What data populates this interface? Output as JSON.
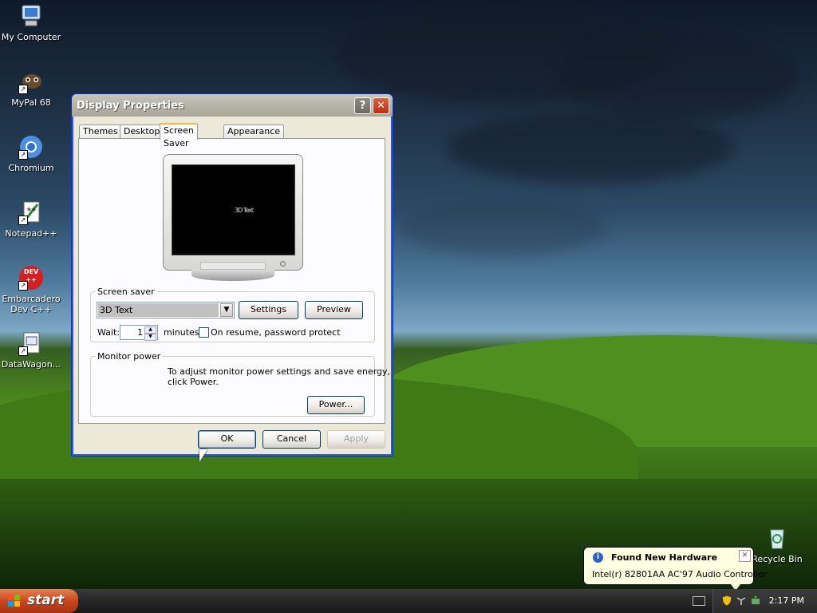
{
  "desktop": {
    "icons": [
      {
        "label": "My Computer",
        "icon": "computer-icon"
      },
      {
        "label": "MyPal 68",
        "icon": "browser-mypal-icon"
      },
      {
        "label": "Chromium",
        "icon": "chromium-icon"
      },
      {
        "label": "Notepad++",
        "icon": "notepad-plus-icon"
      },
      {
        "label": "Embarcadero Dev-C++",
        "icon": "dev-cpp-icon"
      },
      {
        "label": "DataWagon...",
        "icon": "datawagon-icon"
      },
      {
        "label": "Recycle Bin",
        "icon": "recycle-bin-icon"
      }
    ],
    "devcpp_logo_text": "DEV ++"
  },
  "window": {
    "title": "Display Properties",
    "help_glyph": "?",
    "close_glyph": "✕",
    "tabs": [
      "Themes",
      "Desktop",
      "Screen Saver",
      "Appearance"
    ],
    "active_tab": "Screen Saver",
    "preview_text": "3D Text",
    "screen_saver": {
      "group_label": "Screen saver",
      "selected": "3D Text",
      "settings_label": "Settings",
      "preview_label": "Preview",
      "wait_label": "Wait:",
      "wait_value": "1",
      "minutes_label": "minutes",
      "password_label": "On resume, password protect",
      "password_checked": false
    },
    "monitor_power": {
      "group_label": "Monitor power",
      "description_line1": "To adjust monitor power settings and save energy,",
      "description_line2": "click Power.",
      "power_label": "Power..."
    },
    "ok_label": "OK",
    "cancel_label": "Cancel",
    "apply_label": "Apply"
  },
  "taskbar": {
    "start_label": "start",
    "clock": "2:17 PM"
  },
  "balloon": {
    "title": "Found New Hardware",
    "message": "Intel(r) 82801AA AC'97 Audio Controller",
    "close_glyph": "✕",
    "info_glyph": "i"
  },
  "colors": {
    "xp_blue": "#0831d9",
    "start_orange": "#c9461e",
    "balloon_bg": "#ffffe1",
    "dialog_bg": "#ece9d8"
  }
}
